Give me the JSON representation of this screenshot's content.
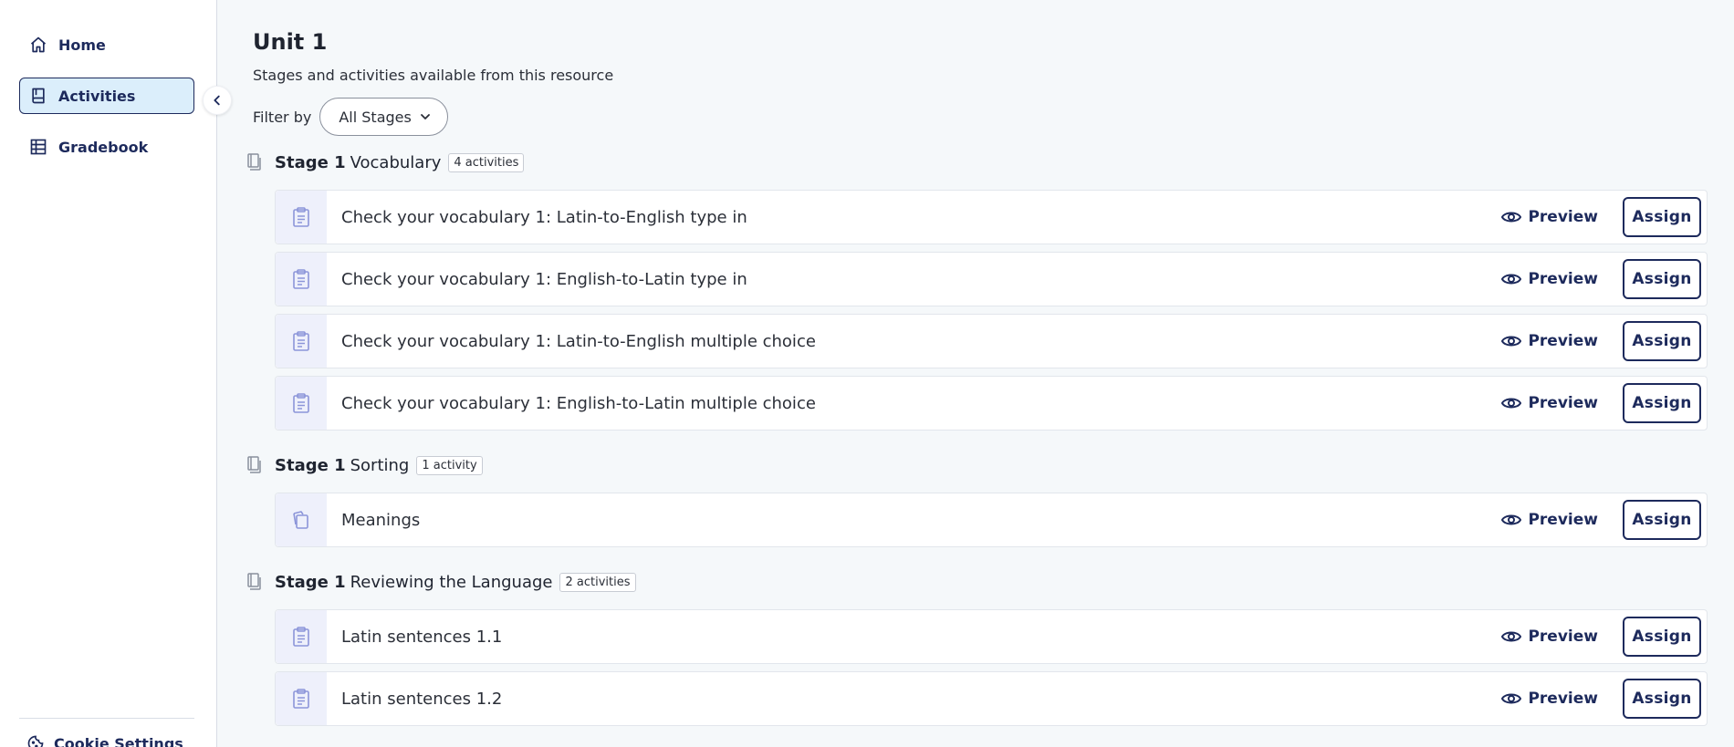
{
  "sidebar": {
    "items": [
      {
        "label": "Home",
        "icon": "home-icon",
        "active": false
      },
      {
        "label": "Activities",
        "icon": "book-icon",
        "active": true
      },
      {
        "label": "Gradebook",
        "icon": "grid-table-icon",
        "active": false
      }
    ],
    "cookie_label": "Cookie Settings"
  },
  "main": {
    "title": "Unit 1",
    "subtitle": "Stages and activities available from this resource",
    "filter_label": "Filter by",
    "filter_value": "All Stages",
    "preview_label": "Preview",
    "assign_label": "Assign",
    "sections": [
      {
        "stage": "Stage 1",
        "name": "Vocabulary",
        "count": "4 activities",
        "activities": [
          {
            "title": "Check your vocabulary 1: Latin-to-English type in",
            "icon": "clipboard-icon"
          },
          {
            "title": "Check your vocabulary 1: English-to-Latin type in",
            "icon": "clipboard-icon"
          },
          {
            "title": "Check your vocabulary 1: Latin-to-English multiple choice",
            "icon": "clipboard-icon"
          },
          {
            "title": "Check your vocabulary 1: English-to-Latin multiple choice",
            "icon": "clipboard-icon"
          }
        ]
      },
      {
        "stage": "Stage 1",
        "name": "Sorting",
        "count": "1 activity",
        "activities": [
          {
            "title": "Meanings",
            "icon": "cards-icon"
          }
        ]
      },
      {
        "stage": "Stage 1",
        "name": "Reviewing the Language",
        "count": "2 activities",
        "activities": [
          {
            "title": "Latin sentences 1.1",
            "icon": "clipboard-icon"
          },
          {
            "title": "Latin sentences 1.2",
            "icon": "clipboard-icon"
          }
        ]
      }
    ]
  },
  "colors": {
    "navy": "#1d2a5c",
    "active_bg": "#dbeefb",
    "icon_box_bg": "#eef0fb",
    "icon_accent": "#8c95d9",
    "page_bg": "#f5f8fa"
  }
}
